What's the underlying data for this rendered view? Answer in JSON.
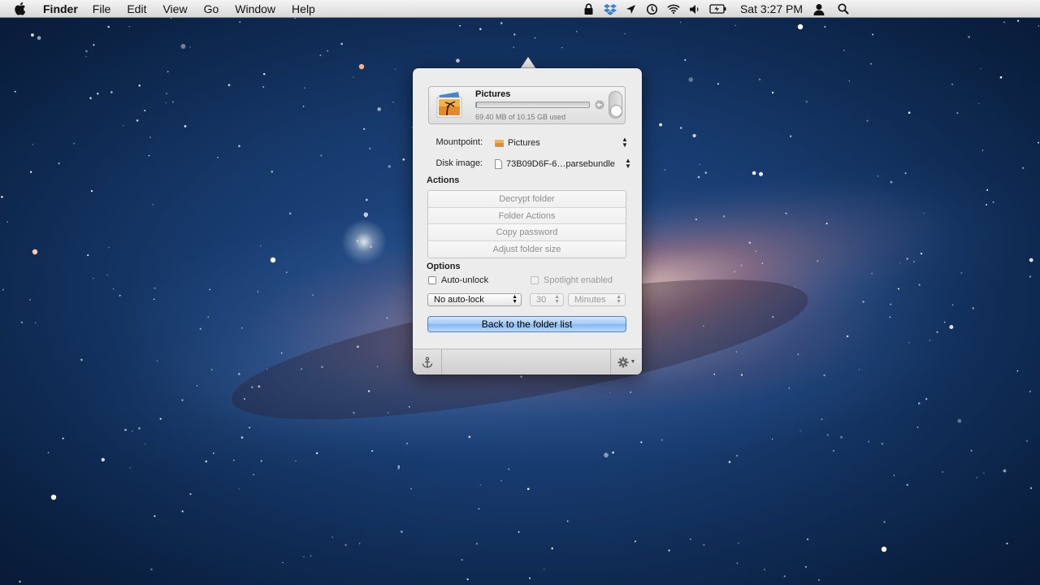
{
  "menubar": {
    "app_name": "Finder",
    "menus": [
      "File",
      "Edit",
      "View",
      "Go",
      "Window",
      "Help"
    ],
    "status_icons": [
      "lock-icon",
      "dropbox-icon",
      "location-icon",
      "time-machine-icon",
      "wifi-icon",
      "volume-icon",
      "battery-icon"
    ],
    "clock": "Sat 3:27 PM"
  },
  "popover": {
    "folder": {
      "name": "Pictures",
      "usage_text": "69.40 MB of 10.15 GB used",
      "usage_fraction": 0.007,
      "unlocked": false
    },
    "mountpoint": {
      "label": "Mountpoint:",
      "value": "Pictures"
    },
    "disk_image": {
      "label": "Disk image:",
      "value": "73B09D6F-6…parsebundle"
    },
    "actions": {
      "title": "Actions",
      "buttons": [
        "Decrypt folder",
        "Folder Actions",
        "Copy password",
        "Adjust folder size"
      ]
    },
    "options": {
      "title": "Options",
      "auto_unlock_label": "Auto-unlock",
      "auto_unlock_checked": false,
      "spotlight_label": "Spotlight enabled",
      "spotlight_checked": false,
      "auto_lock_value": "No auto-lock",
      "lock_amount": "30",
      "lock_unit": "Minutes"
    },
    "back_button_label": "Back to the folder list"
  },
  "colors": {
    "menubar": "#e6e6e6",
    "popover_bg": "#ececec",
    "accent_button": "#a3c9f4",
    "desktop": "#173a6d"
  }
}
